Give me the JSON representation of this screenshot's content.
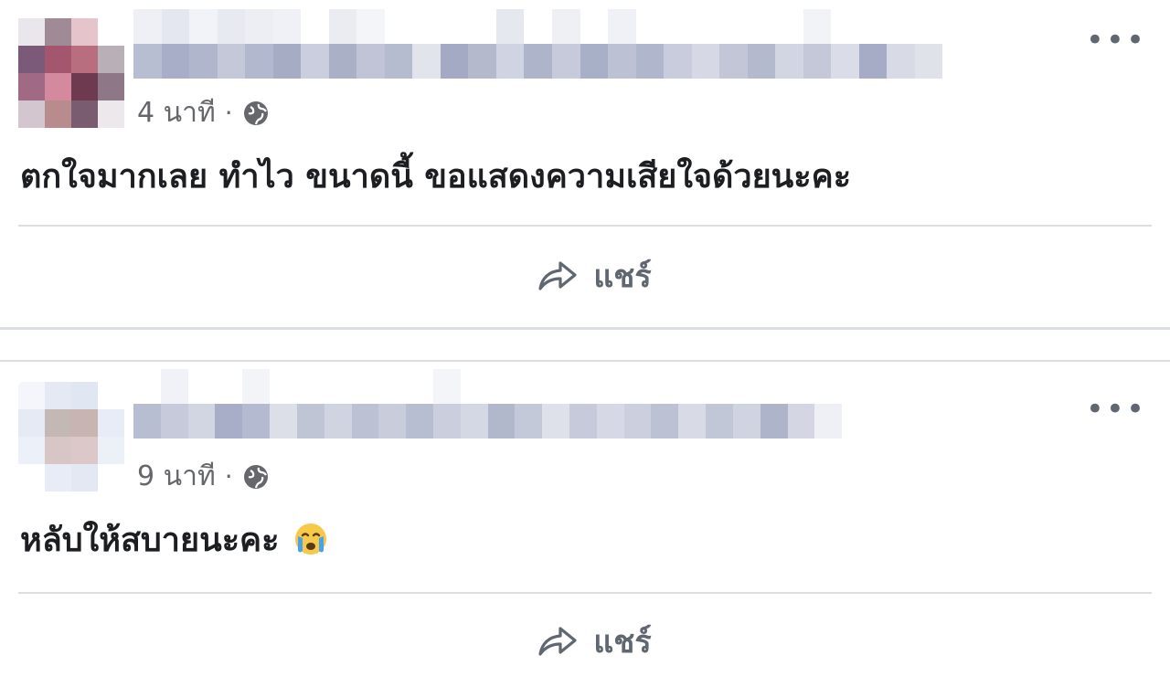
{
  "posts": [
    {
      "time": "4 นาที",
      "separator": "·",
      "visibility_icon": "globe-icon",
      "message": "ตกใจมากเลย ทำไว ขนาดนี้ ขอแสดงความเสียใจด้วยนะคะ",
      "share_label": "แชร์",
      "more_label": "•••"
    },
    {
      "time": "9 นาที",
      "separator": "·",
      "visibility_icon": "globe-icon",
      "message": "หลับให้สบายนะคะ",
      "emoji_icon": "crying-face-icon",
      "share_label": "แชร์",
      "more_label": "•••"
    }
  ],
  "colors": {
    "text_primary": "#1c1e21",
    "text_secondary": "#65676b",
    "divider": "#dadde1"
  }
}
